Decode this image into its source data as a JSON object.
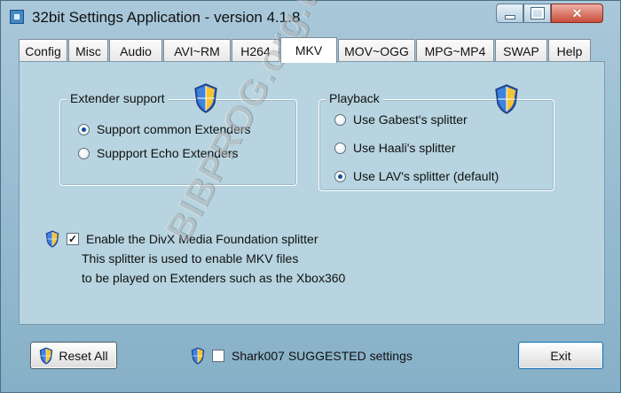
{
  "window": {
    "title": "32bit Settings Application - version 4.1.8",
    "buttons": {
      "minimize": "minimize",
      "maximize": "maximize",
      "close": "close"
    }
  },
  "tabs": [
    {
      "label": "Config"
    },
    {
      "label": "Misc"
    },
    {
      "label": "Audio"
    },
    {
      "label": "AVI~RM"
    },
    {
      "label": "H264"
    },
    {
      "label": "MKV",
      "active": true
    },
    {
      "label": "MOV~OGG"
    },
    {
      "label": "MPG~MP4"
    },
    {
      "label": "SWAP"
    },
    {
      "label": "Help"
    }
  ],
  "extender_support": {
    "title": "Extender support",
    "options": [
      {
        "label": "Support common Extenders",
        "selected": true
      },
      {
        "label": "Suppport Echo Extenders",
        "selected": false
      }
    ]
  },
  "playback": {
    "title": "Playback",
    "options": [
      {
        "label": "Use Gabest's splitter",
        "selected": false
      },
      {
        "label": "Use Haali's splitter",
        "selected": false
      },
      {
        "label": "Use LAV's splitter (default)",
        "selected": true
      }
    ]
  },
  "divx": {
    "label": "Enable the DivX Media Foundation splitter",
    "checked": true,
    "description_line_1": "This splitter is used to enable MKV files",
    "description_line_2": "to be played on Extenders such as the Xbox360"
  },
  "footer": {
    "reset_label": "Reset All",
    "suggested_label": "Shark007 SUGGESTED settings",
    "suggested_checked": false,
    "exit_label": "Exit"
  },
  "watermark": {
    "text": "BIBPROG.org.ua"
  },
  "icons": {
    "app": "app-icon",
    "shield": "shield-icon",
    "close": "close-icon"
  },
  "colors": {
    "window_blue": "#a9c8da",
    "panel_blue": "#b7d4e0",
    "close_red": "#c84d3a",
    "radio_blue": "#0b4f9c"
  }
}
